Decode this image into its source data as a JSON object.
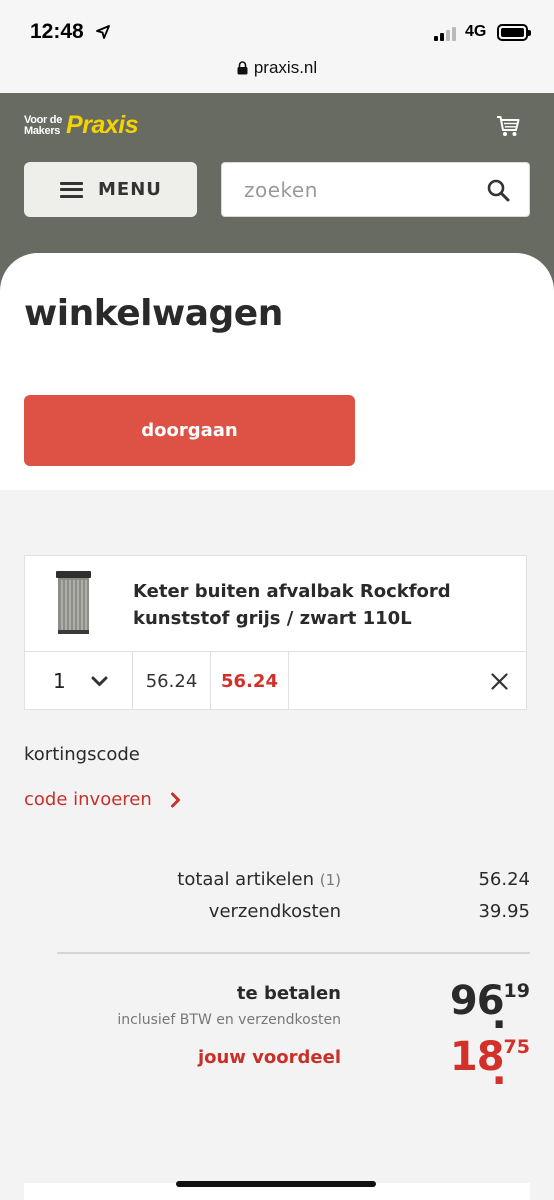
{
  "status_bar": {
    "time": "12:48",
    "network": "4G"
  },
  "browser": {
    "url": "praxis.nl"
  },
  "header": {
    "logo_small_line1": "Voor de",
    "logo_small_line2": "Makers",
    "logo_brand": "Praxis",
    "menu_label": "MENU",
    "search_placeholder": "zoeken"
  },
  "page": {
    "title": "winkelwagen",
    "cta_label": "doorgaan"
  },
  "cart_item": {
    "name": "Keter buiten afvalbak Rockford kunststof grijs / zwart 110L",
    "quantity": "1",
    "unit_price": "56.24",
    "line_total": "56.24"
  },
  "discount": {
    "label": "kortingscode",
    "link": "code invoeren"
  },
  "totals": {
    "items_label": "totaal artikelen",
    "items_count": "(1)",
    "items_value": "56.24",
    "shipping_label": "verzendkosten",
    "shipping_value": "39.95",
    "pay_label": "te betalen",
    "pay_sub": "inclusief BTW en verzendkosten",
    "pay_whole": "96",
    "pay_cents": "19",
    "savings_label": "jouw voordeel",
    "savings_whole": "18",
    "savings_cents": "75"
  },
  "colors": {
    "header_bg": "#676b62",
    "accent_red": "#de5246",
    "price_red": "#d4302a",
    "brand_yellow": "#f5d300"
  }
}
